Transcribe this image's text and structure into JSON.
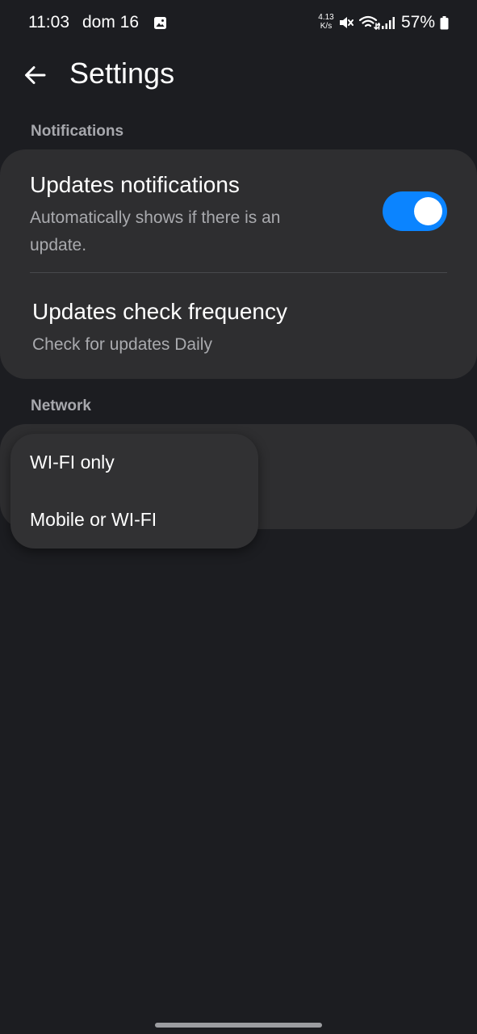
{
  "status_bar": {
    "time": "11:03",
    "date": "dom 16",
    "net_speed_value": "4.13",
    "net_speed_unit": "K/s",
    "battery_percent": "57%"
  },
  "app_bar": {
    "title": "Settings"
  },
  "notifications": {
    "header": "Notifications",
    "updates_notifications": {
      "title": "Updates notifications",
      "subtitle_line1": "Automatically shows if there is an",
      "subtitle_line2": "update.",
      "enabled": true
    },
    "check_frequency": {
      "title": "Updates check frequency",
      "subtitle": "Check for updates Daily"
    }
  },
  "network": {
    "header": "Network",
    "dropdown_options": [
      "WI-FI only",
      "Mobile or WI-FI"
    ]
  },
  "colors": {
    "background": "#1c1d21",
    "card": "#2e2e30",
    "accent": "#0b84ff",
    "secondary_text": "#a9aaae"
  },
  "icons": {
    "back": "arrow-left-icon",
    "gallery": "gallery-icon",
    "mute": "mute-icon",
    "wifi": "wifi-icon",
    "signal": "signal-icon",
    "battery": "battery-icon"
  }
}
